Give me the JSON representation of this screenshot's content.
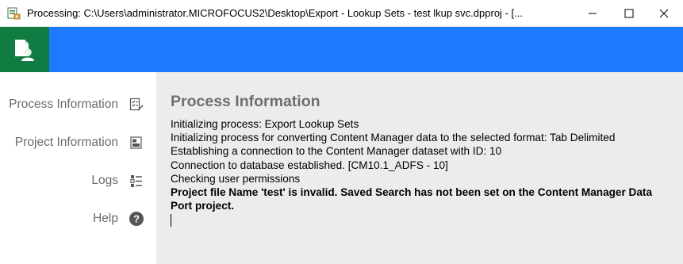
{
  "window": {
    "title": "Processing: C:\\Users\\administrator.MICROFOCUS2\\Desktop\\Export - Lookup Sets - test lkup svc.dpproj - [...",
    "controls": {
      "minimize_icon": "minimize-icon",
      "maximize_icon": "maximize-icon",
      "close_icon": "close-icon"
    }
  },
  "header": {
    "brand_color": "#1e7bff",
    "logo_color": "#107c41",
    "logo_icon": "document-user-icon"
  },
  "sidebar": {
    "items": [
      {
        "label": "Process Information",
        "icon": "checklist-icon"
      },
      {
        "label": "Project Information",
        "icon": "project-icon"
      },
      {
        "label": "Logs",
        "icon": "logs-icon"
      },
      {
        "label": "Help",
        "icon": "help-icon"
      }
    ]
  },
  "main": {
    "title": "Process Information",
    "log_lines": [
      {
        "text": "Initializing process: Export Lookup Sets",
        "bold": false
      },
      {
        "text": "Initializing process for converting Content Manager data to the selected format: Tab Delimited",
        "bold": false
      },
      {
        "text": "Establishing a connection to the Content Manager dataset with ID: 10",
        "bold": false
      },
      {
        "text": "Connection to database established. [CM10.1_ADFS - 10]",
        "bold": false
      },
      {
        "text": "Checking user permissions",
        "bold": false
      },
      {
        "text": "Project file Name 'test' is invalid. Saved Search has not been set on the Content Manager Data Port project.",
        "bold": true
      }
    ]
  }
}
